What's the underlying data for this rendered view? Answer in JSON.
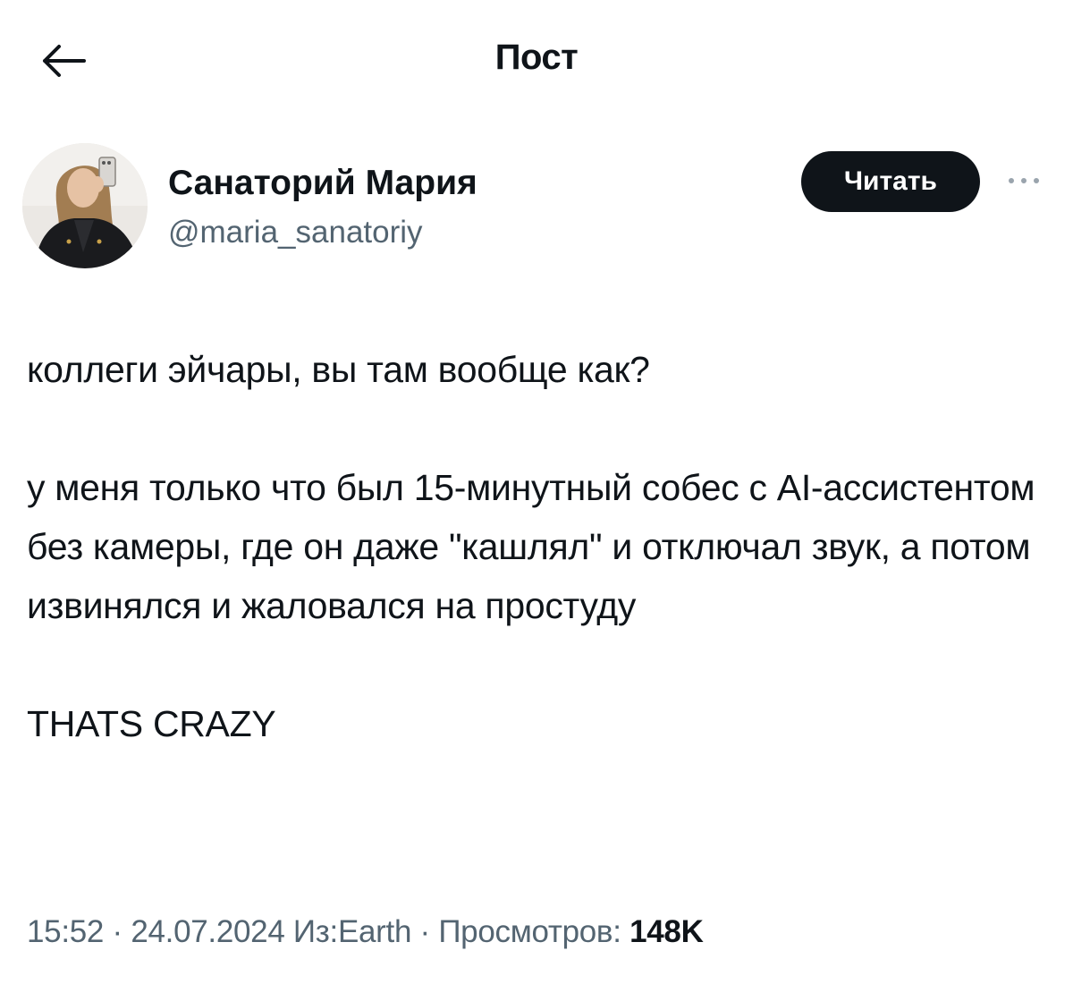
{
  "header": {
    "title": "Пост",
    "back_icon": "arrow-left-icon"
  },
  "author": {
    "name": "Санаторий Мария",
    "handle": "@maria_sanatoriy",
    "follow_label": "Читать",
    "more_icon": "more-horizontal-icon"
  },
  "post": {
    "paragraphs": [
      "коллеги эйчары, вы там вообще как?",
      "у меня только что был 15-минутный собес с AI-ассистентом без камеры, где он даже \"кашлял\" и отключал звук, а потом извинялся и жаловался на простуду",
      "THATS CRAZY"
    ]
  },
  "meta": {
    "time": "15:52",
    "separator": " · ",
    "date": "24.07.2024",
    "source": "Из:Earth",
    "views_label": "Просмотров: ",
    "views_count": "148K"
  },
  "colors": {
    "text": "#0f1419",
    "secondary": "#536471",
    "button_bg": "#0f1419",
    "button_text": "#ffffff",
    "background": "#ffffff"
  }
}
